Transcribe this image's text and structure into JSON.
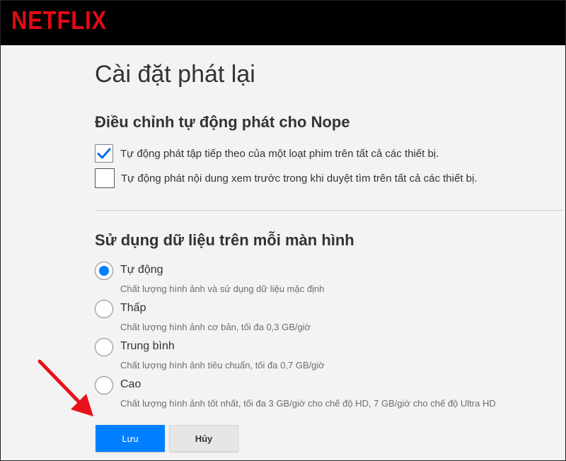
{
  "header": {
    "logo_text": "NETFLIX"
  },
  "page": {
    "title": "Cài đặt phát lại"
  },
  "autoplay": {
    "title": "Điều chỉnh tự động phát cho Nope",
    "options": [
      {
        "label": "Tự động phát tập tiếp theo của một loạt phim trên tất cả các thiết bị.",
        "checked": true
      },
      {
        "label": "Tự động phát nội dung xem trước trong khi duyệt tìm trên tất cả các thiết bị.",
        "checked": false
      }
    ]
  },
  "data_usage": {
    "title": "Sử dụng dữ liệu trên mỗi màn hình",
    "selected": "Tự động",
    "options": [
      {
        "label": "Tự động",
        "description": "Chất lượng hình ảnh và sử dụng dữ liệu mặc định"
      },
      {
        "label": "Thấp",
        "description": "Chất lượng hình ảnh cơ bản, tối đa 0,3 GB/giờ"
      },
      {
        "label": "Trung bình",
        "description": "Chất lượng hình ảnh tiêu chuẩn, tối đa 0,7 GB/giờ"
      },
      {
        "label": "Cao",
        "description": "Chất lượng hình ảnh tốt nhất, tối đa 3 GB/giờ cho chế độ HD, 7 GB/giờ cho chế độ Ultra HD"
      }
    ]
  },
  "buttons": {
    "save_label": "Lưu",
    "cancel_label": "Hủy"
  },
  "colors": {
    "brand": "#e50914",
    "accent": "#0080ff",
    "annotation_arrow": "#e8121a"
  },
  "icons": {
    "checkbox_checked": "checkmark-icon",
    "annotation": "red-arrow-icon"
  }
}
